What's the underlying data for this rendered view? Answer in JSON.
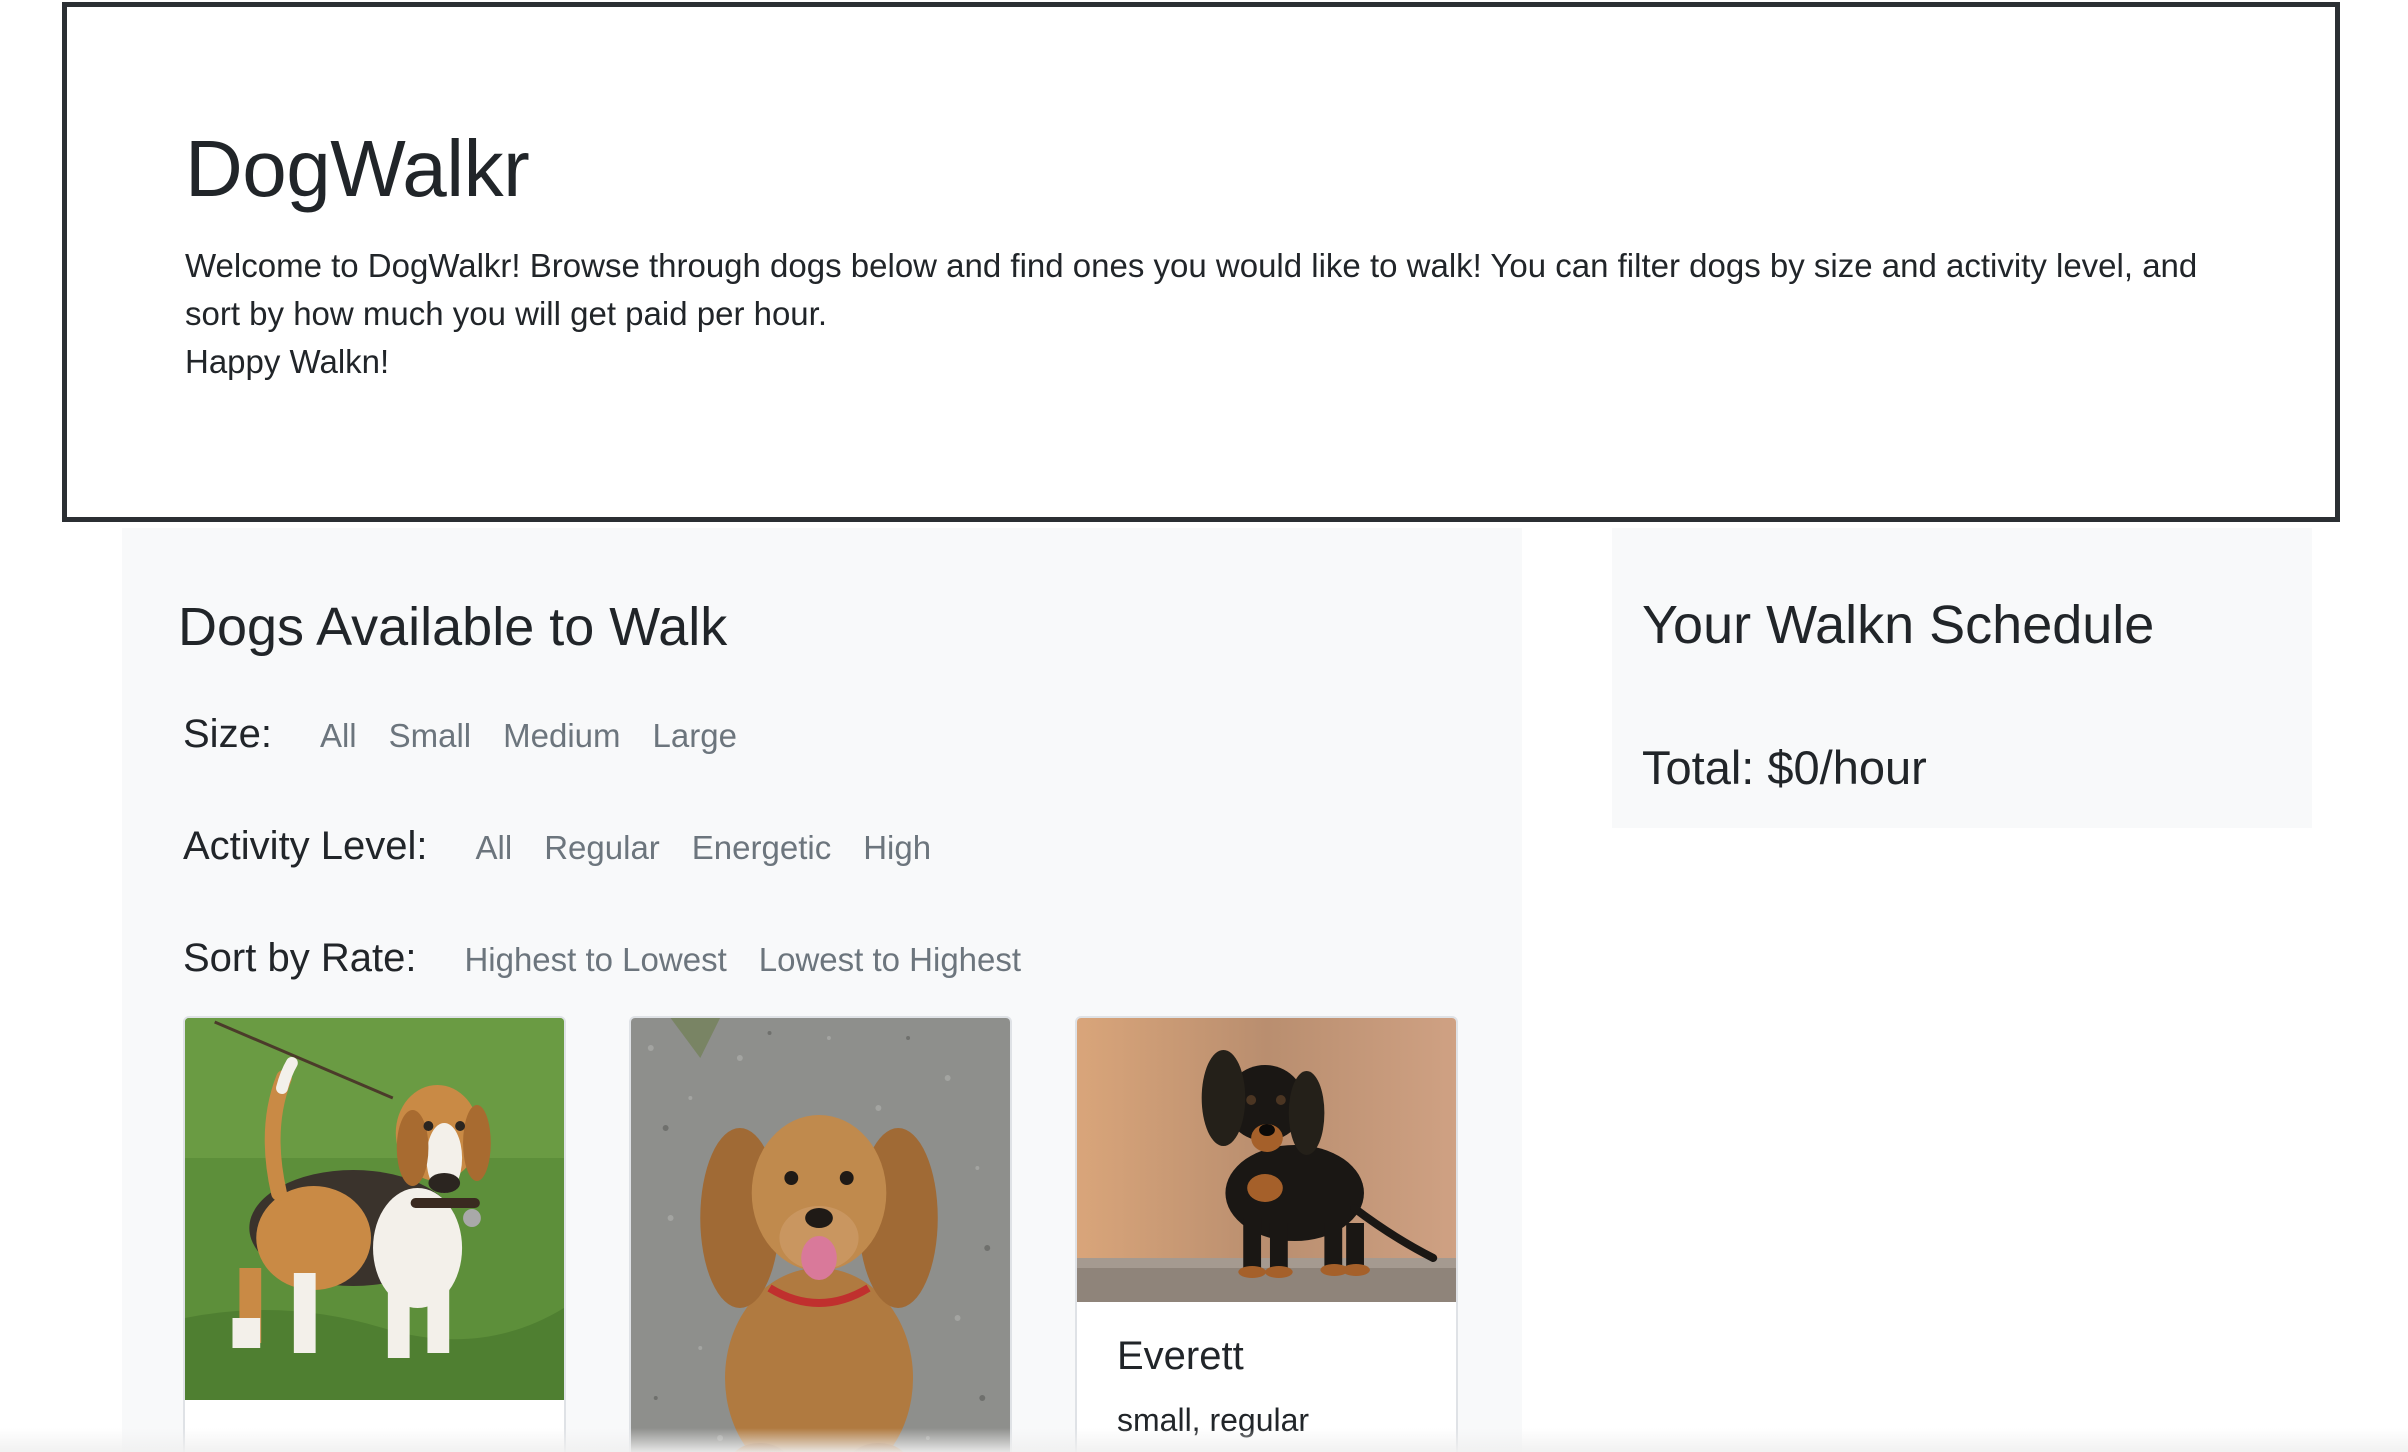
{
  "hero": {
    "title": "DogWalkr",
    "description_line1": "Welcome to DogWalkr! Browse through dogs below and find ones you would like to walk! You can filter dogs by size and activity level, and",
    "description_line2": "sort by how much you will get paid per hour.",
    "description_line3": "Happy Walkn!"
  },
  "dogs_panel": {
    "title": "Dogs Available to Walk",
    "size_filter": {
      "label": "Size:",
      "options": [
        "All",
        "Small",
        "Medium",
        "Large"
      ]
    },
    "activity_filter": {
      "label": "Activity Level:",
      "options": [
        "All",
        "Regular",
        "Energetic",
        "High"
      ]
    },
    "sort": {
      "label": "Sort by Rate:",
      "options": [
        "Highest to Lowest",
        "Lowest to Highest"
      ]
    },
    "cards": [
      {
        "name": "",
        "meta": "",
        "image": "beagle-photo"
      },
      {
        "name": "",
        "meta": "",
        "image": "cocker-spaniel-photo"
      },
      {
        "name": "Everett",
        "meta": "small, regular",
        "image": "dachshund-photo"
      }
    ]
  },
  "schedule": {
    "title": "Your Walkn Schedule",
    "total": "Total: $0/hour"
  },
  "colors": {
    "panel_bg": "#f8f9fa",
    "text_dark": "#212529",
    "text_muted": "#6c757d",
    "hero_border": "#2b2f33"
  }
}
